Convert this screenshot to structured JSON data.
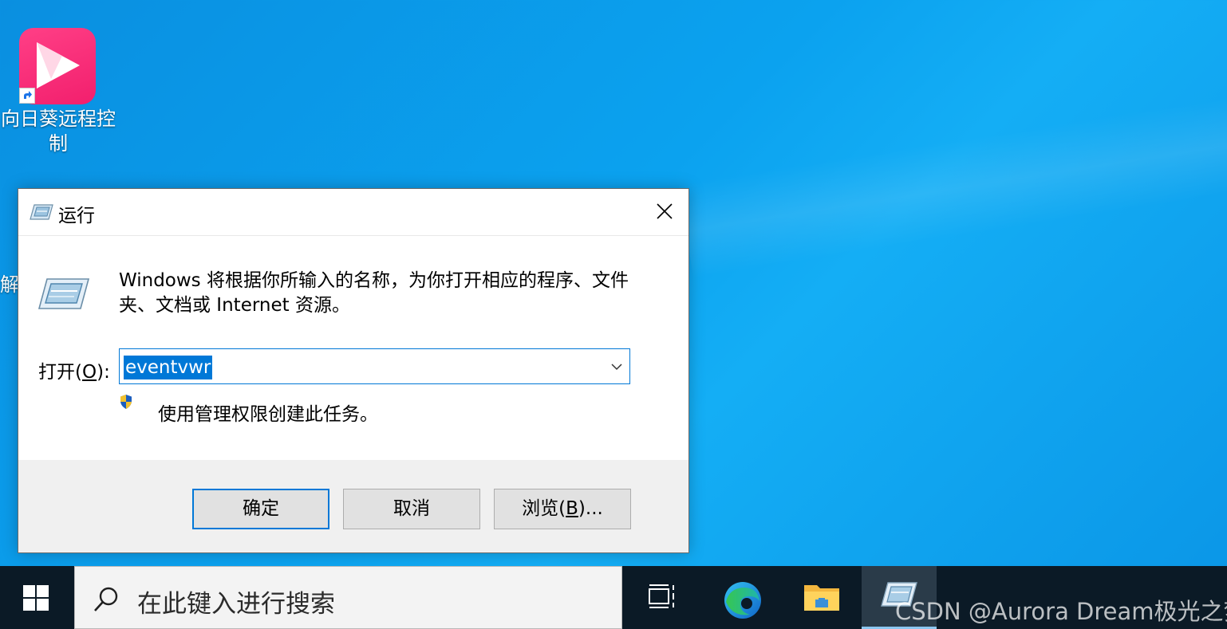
{
  "desktop": {
    "shortcut": {
      "label": "向日葵远程控制",
      "icon": "sunlogin-remote-icon"
    },
    "partial_label": "解"
  },
  "run_dialog": {
    "title": "运行",
    "close_icon": "close-icon",
    "description": "Windows 将根据你所输入的名称，为你打开相应的程序、文件夹、文档或 Internet 资源。",
    "open_label_prefix": "打开(",
    "open_label_key": "O",
    "open_label_suffix": "):",
    "open_value": "eventvwr",
    "admin_note": "使用管理权限创建此任务。",
    "buttons": {
      "ok": "确定",
      "cancel": "取消",
      "browse_prefix": "浏览(",
      "browse_key": "B",
      "browse_suffix": ")..."
    }
  },
  "taskbar": {
    "search_placeholder": "在此键入进行搜索",
    "apps": [
      "task-view-icon",
      "edge-icon",
      "file-explorer-icon",
      "run-icon"
    ]
  },
  "watermark": "CSDN @Aurora Dream极光之梦",
  "colors": {
    "accent": "#0078d7",
    "taskbar": "#0b1a26",
    "app_tile": "#f21f6d"
  }
}
